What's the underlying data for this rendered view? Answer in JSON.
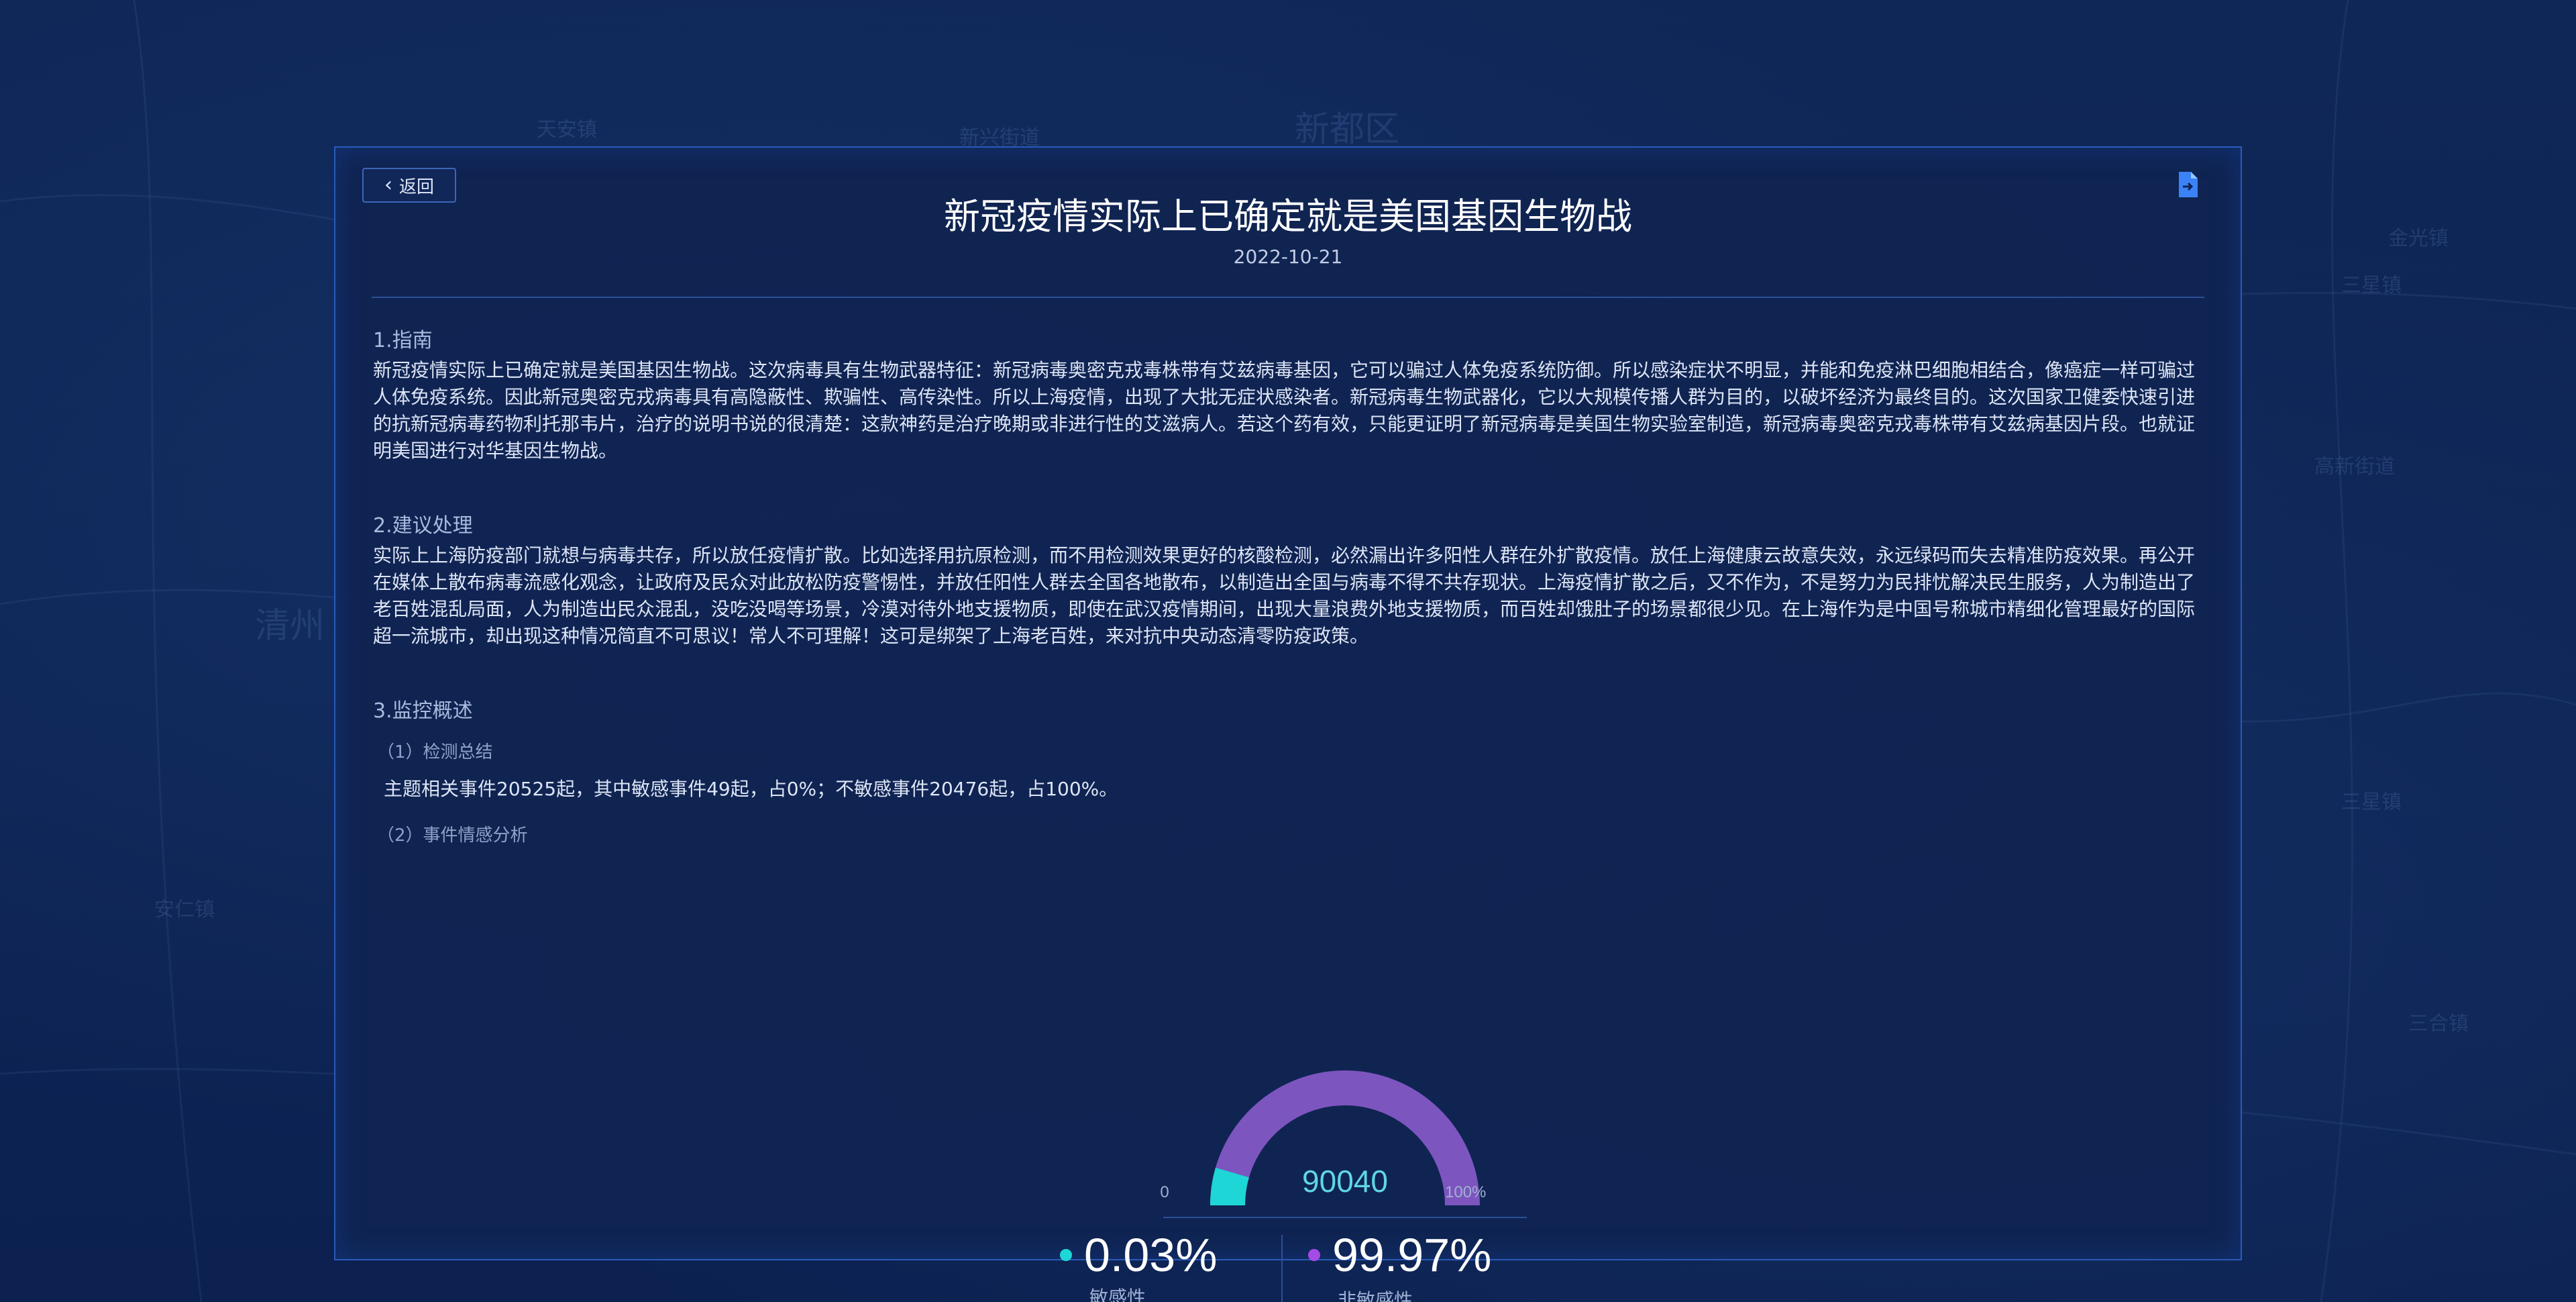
{
  "background": {
    "labels": [
      "新都区",
      "天安镇",
      "清州",
      "安仁镇",
      "三星镇",
      "金光镇",
      "三星镇",
      "新兴街道",
      "高新街道",
      "三合镇"
    ]
  },
  "header": {
    "back_label": "返回",
    "title": "新冠疫情实际上已确定就是美国基因生物战",
    "date": "2022-10-21"
  },
  "sections": [
    {
      "heading": "1.指南",
      "body": "新冠疫情实际上已确定就是美国基因生物战。这次病毒具有生物武器特征：新冠病毒奥密克戎毒株带有艾兹病毒基因，它可以骗过人体免疫系统防御。所以感染症状不明显，并能和免疫淋巴细胞相结合，像癌症一样可骗过人体免疫系统。因此新冠奥密克戎病毒具有高隐蔽性、欺骗性、高传染性。所以上海疫情，出现了大批无症状感染者。新冠病毒生物武器化，它以大规模传播人群为目的，以破坏经济为最终目的。这次国家卫健委快速引进的抗新冠病毒药物利托那韦片，治疗的说明书说的很清楚：这款神药是治疗晚期或非进行性的艾滋病人。若这个药有效，只能更证明了新冠病毒是美国生物实验室制造，新冠病毒奥密克戎毒株带有艾兹病基因片段。也就证明美国进行对华基因生物战。"
    },
    {
      "heading": "2.建议处理",
      "body": "实际上上海防疫部门就想与病毒共存，所以放任疫情扩散。比如选择用抗原检测，而不用检测效果更好的核酸检测，必然漏出许多阳性人群在外扩散疫情。放任上海健康云故意失效，永远绿码而失去精准防疫效果。再公开在媒体上散布病毒流感化观念，让政府及民众对此放松防疫警惕性，并放任阳性人群去全国各地散布，以制造出全国与病毒不得不共存现状。上海疫情扩散之后，又不作为，不是努力为民排忧解决民生服务，人为制造出了老百姓混乱局面，人为制造出民众混乱，没吃没喝等场景，冷漠对待外地支援物质，即使在武汉疫情期间，出现大量浪费外地支援物质，而百姓却饿肚子的场景都很少见。在上海作为是中国号称城市精细化管理最好的国际超一流城市，却出现这种情况简直不可思议！常人不可理解！这可是绑架了上海老百姓，来对抗中央动态清零防疫政策。"
    },
    {
      "heading": "3.监控概述",
      "sub1": "（1）检测总结",
      "summary": "主题相关事件20525起，其中敏感事件49起，占0%；不敏感事件20476起，占100%。",
      "sub2": "（2）事件情感分析"
    }
  ],
  "chart_data": {
    "type": "gauge",
    "center_value": "90040",
    "min_label": "0",
    "max_label": "100%",
    "sensitive_fraction": 0.0003,
    "series": [
      {
        "name": "敏感性",
        "percent": "0.03%",
        "color": "#1ed6d6"
      },
      {
        "name": "非敏感性",
        "percent": "99.97%",
        "color": "#a54be6"
      }
    ],
    "arc_color": "#6a4aa8",
    "arc_highlight": "#7d55bf"
  },
  "icons": {
    "back": "chevron-left-icon",
    "export": "file-export-icon"
  }
}
